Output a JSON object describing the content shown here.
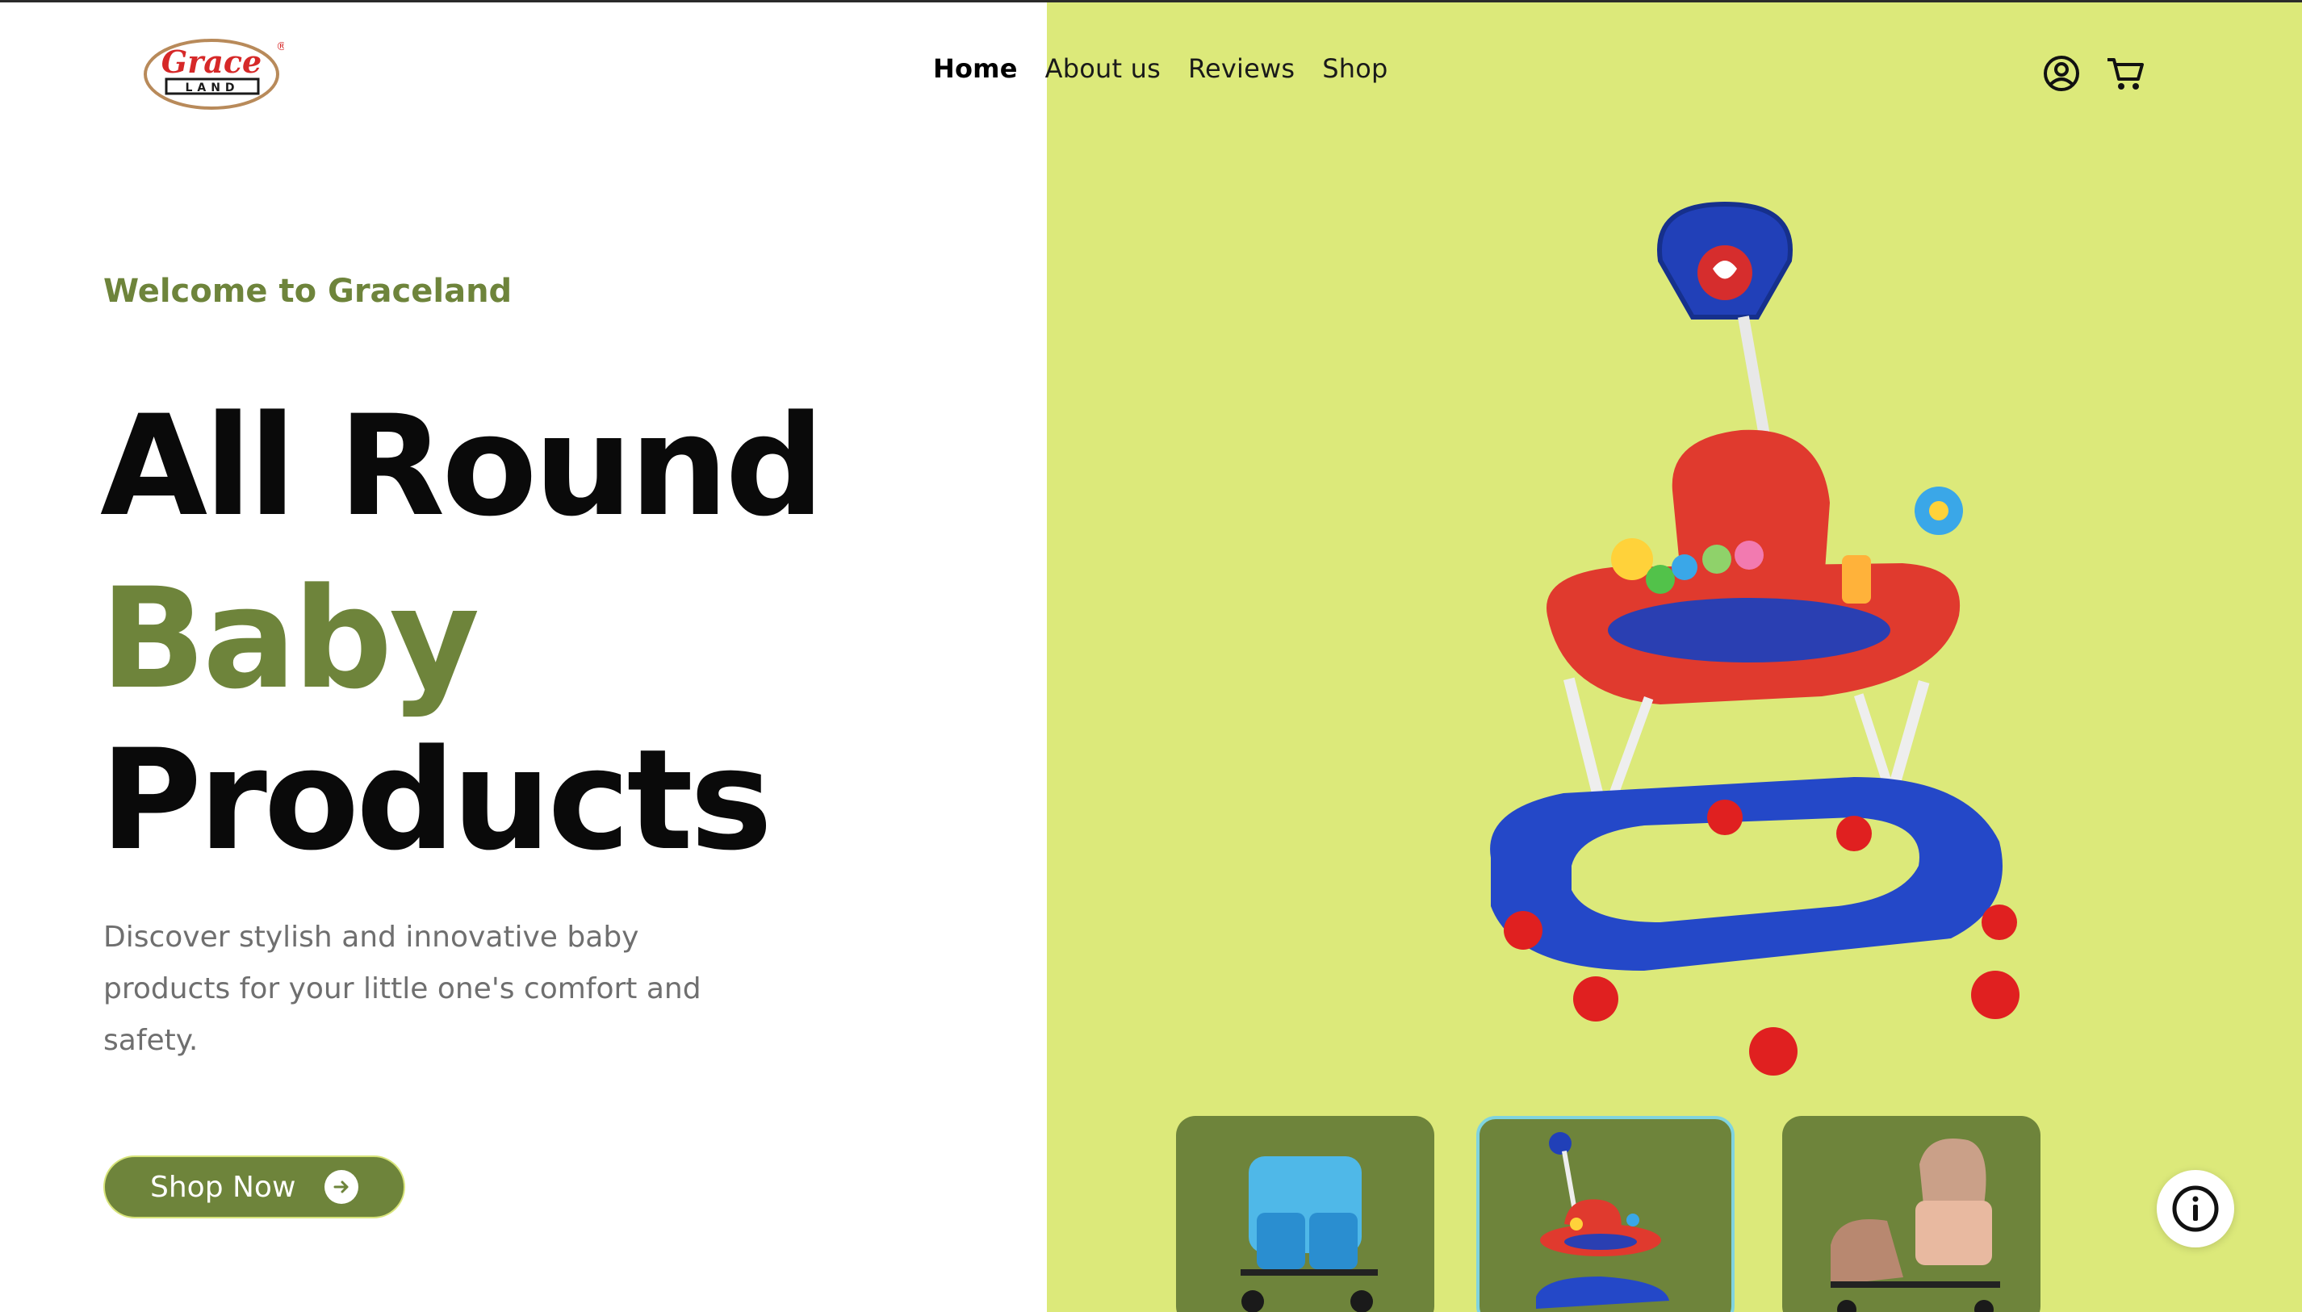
{
  "brand": {
    "name": "Grace LAND",
    "logo_top": "Grace",
    "logo_bottom": "LAND",
    "registered_mark": "®"
  },
  "nav": {
    "items": [
      {
        "label": "Home",
        "active": true
      },
      {
        "label": "About us",
        "active": false
      },
      {
        "label": "Reviews",
        "active": false
      },
      {
        "label": "Shop",
        "active": false
      }
    ]
  },
  "header_icons": [
    "user-circle-icon",
    "shopping-cart-icon"
  ],
  "hero": {
    "welcome": "Welcome to Graceland",
    "title_line1": "All Round",
    "title_line2": "Baby",
    "title_line3": "Products",
    "description": "Discover stylish and innovative baby products for your little one's comfort and safety.",
    "cta_label": "Shop Now",
    "cta_icon": "arrow-right-icon"
  },
  "gallery": {
    "main_image": "baby-walker",
    "thumbnails": [
      {
        "name": "twin-stroller",
        "selected": false
      },
      {
        "name": "baby-walker",
        "selected": true
      },
      {
        "name": "pram-stroller",
        "selected": false
      }
    ]
  },
  "colors": {
    "accent_green": "#6e843b",
    "lime_panel": "#dce97a",
    "text_dark": "#0a0a0a",
    "text_muted": "#6f6f6f"
  },
  "info_icon": "info-icon"
}
